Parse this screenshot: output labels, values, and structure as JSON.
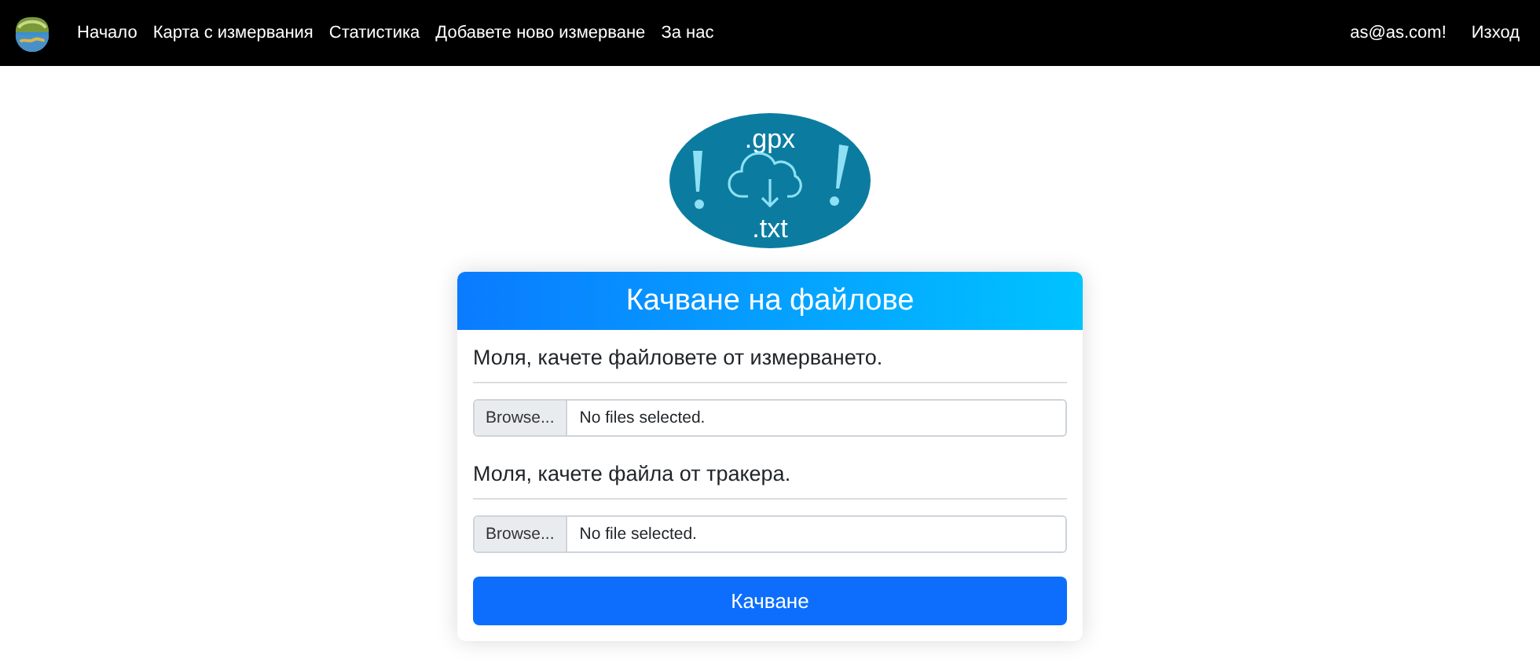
{
  "navbar": {
    "links": [
      {
        "label": "Начало"
      },
      {
        "label": "Карта с измервания"
      },
      {
        "label": "Статистика"
      },
      {
        "label": "Добавете ново измерване"
      },
      {
        "label": "За нас"
      }
    ],
    "user": "as@as.com!",
    "logout": "Изход"
  },
  "logo": {
    "top_text": ".gpx",
    "bottom_text": ".txt"
  },
  "card": {
    "title": "Качване на файлове",
    "fields": [
      {
        "label": "Моля, качете файловете от измерването.",
        "button": "Browse...",
        "value": "No files selected."
      },
      {
        "label": "Моля, качете файла от тракера.",
        "button": "Browse...",
        "value": "No file selected."
      }
    ],
    "submit": "Качване"
  }
}
